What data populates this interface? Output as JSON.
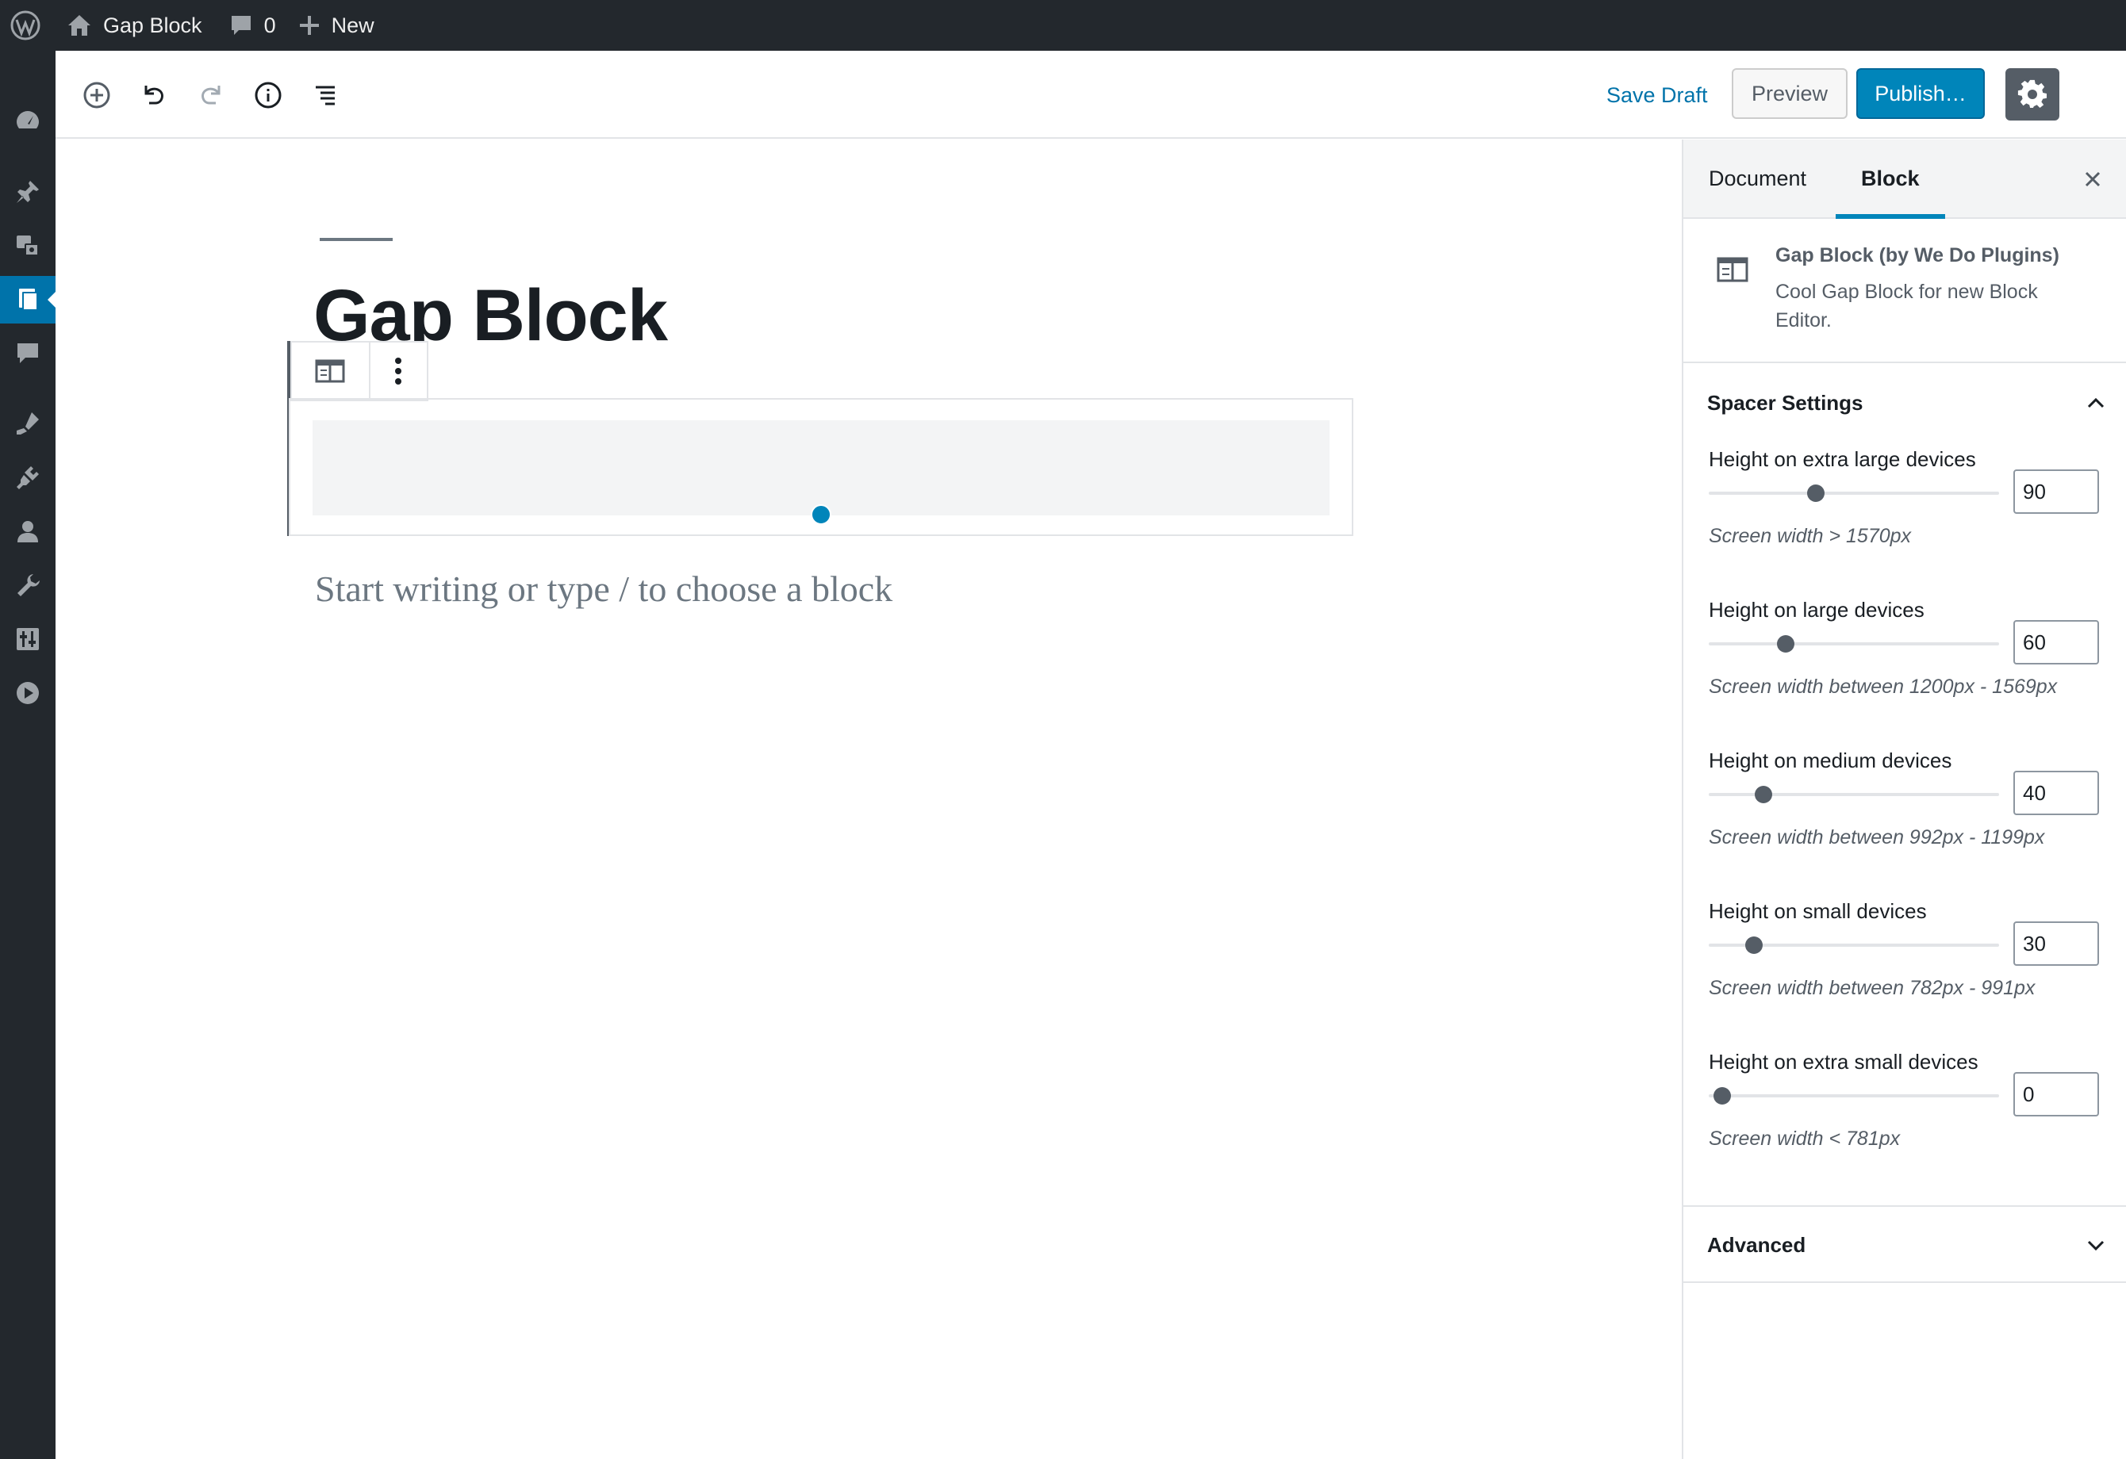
{
  "admin_bar": {
    "site_name": "Gap Block",
    "comments_count": "0",
    "new_label": "New"
  },
  "header": {
    "save_draft": "Save Draft",
    "preview": "Preview",
    "publish": "Publish…"
  },
  "editor": {
    "post_title": "Gap Block",
    "placeholder": "Start writing or type / to choose a block"
  },
  "sidebar": {
    "tabs": [
      "Document",
      "Block"
    ],
    "active_tab": "Block",
    "block_card": {
      "title": "Gap Block (by We Do Plugins)",
      "description": "Cool Gap Block for new Block Editor."
    },
    "spacer_panel": {
      "title": "Spacer Settings",
      "settings": [
        {
          "label": "Height on extra large devices",
          "value": "90",
          "help": "Screen width > 1570px"
        },
        {
          "label": "Height on large devices",
          "value": "60",
          "help": "Screen width between 1200px - 1569px"
        },
        {
          "label": "Height on medium devices",
          "value": "40",
          "help": "Screen width between 992px - 1199px"
        },
        {
          "label": "Height on small devices",
          "value": "30",
          "help": "Screen width between 782px - 991px"
        },
        {
          "label": "Height on extra small devices",
          "value": "0",
          "help": "Screen width < 781px"
        }
      ]
    },
    "advanced_panel": {
      "title": "Advanced"
    }
  },
  "colors": {
    "admin_bg": "#23282d",
    "accent": "#0085ba",
    "link": "#0073aa"
  }
}
